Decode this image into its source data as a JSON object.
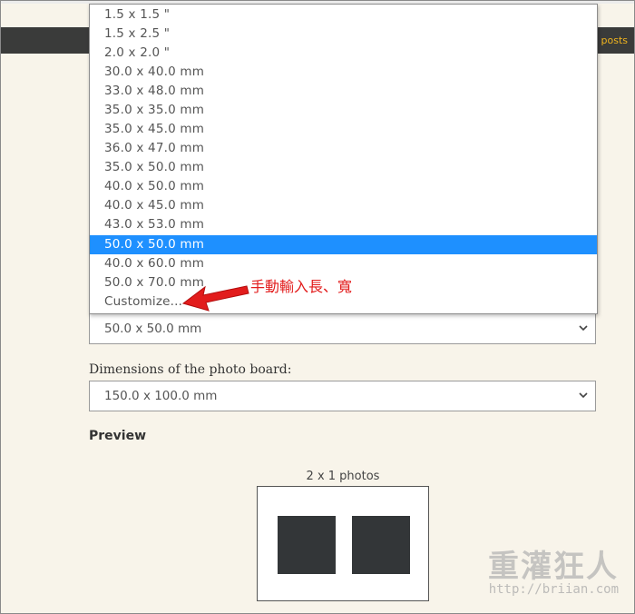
{
  "navbar": {
    "right_text": "g posts"
  },
  "photo_size_dropdown": {
    "options": [
      "1.5 x 1.5 \"",
      "1.5 x 2.5 \"",
      "2.0 x 2.0 \"",
      "30.0 x 40.0 mm",
      "33.0 x 48.0 mm",
      "35.0 x 35.0 mm",
      "35.0 x 45.0 mm",
      "36.0 x 47.0 mm",
      "35.0 x 50.0 mm",
      "40.0 x 50.0 mm",
      "40.0 x 45.0 mm",
      "43.0 x 53.0 mm",
      "50.0 x 50.0 mm",
      "40.0 x 60.0 mm",
      "50.0 x 70.0 mm",
      "Customize..."
    ],
    "selected_index": 12,
    "selected_value": "50.0 x 50.0 mm",
    "selected_color": "#1e90ff"
  },
  "annotation": {
    "text": "手動輸入長、寬",
    "color": "#e21c1c"
  },
  "board": {
    "label": "Dimensions of the photo board:",
    "selected_value": "150.0 x 100.0 mm"
  },
  "preview": {
    "title": "Preview",
    "caption": "2 x 1 photos"
  },
  "watermark": {
    "brand": "重灌狂人",
    "url": "http://briian.com"
  }
}
